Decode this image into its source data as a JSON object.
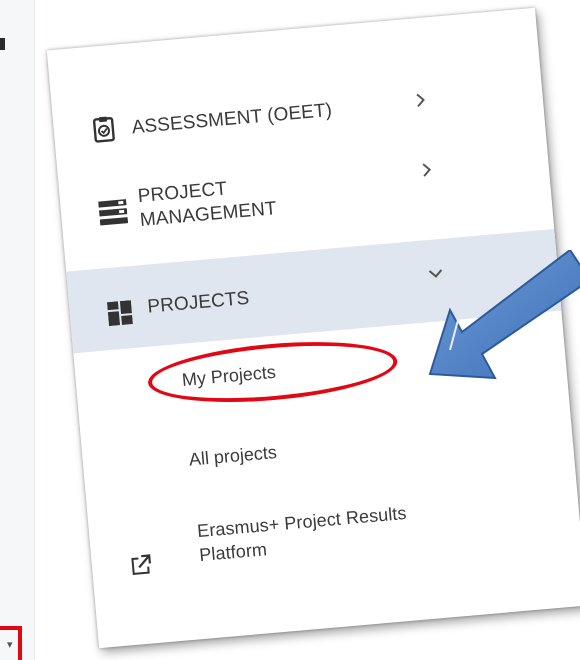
{
  "menu": {
    "assessment_label": "ASSESSMENT (OEET)",
    "project_management_label": "PROJECT\nMANAGEMENT",
    "projects_label": "PROJECTS",
    "submenu": {
      "my_projects": "My Projects",
      "all_projects": "All projects"
    },
    "external_link_label": "Erasmus+ Project Results\nPlatform"
  },
  "colors": {
    "highlight": "#e30613",
    "active_bg": "#dfe6ef",
    "arrow_fill": "#4f81c7"
  },
  "icons": {
    "assessment": "clipboard-check-icon",
    "project_management": "stacked-bars-icon",
    "projects": "dashboard-grid-icon",
    "external_link": "external-link-icon",
    "collapsed_chevron": "chevron-right-icon",
    "expanded_chevron": "chevron-down-icon"
  }
}
